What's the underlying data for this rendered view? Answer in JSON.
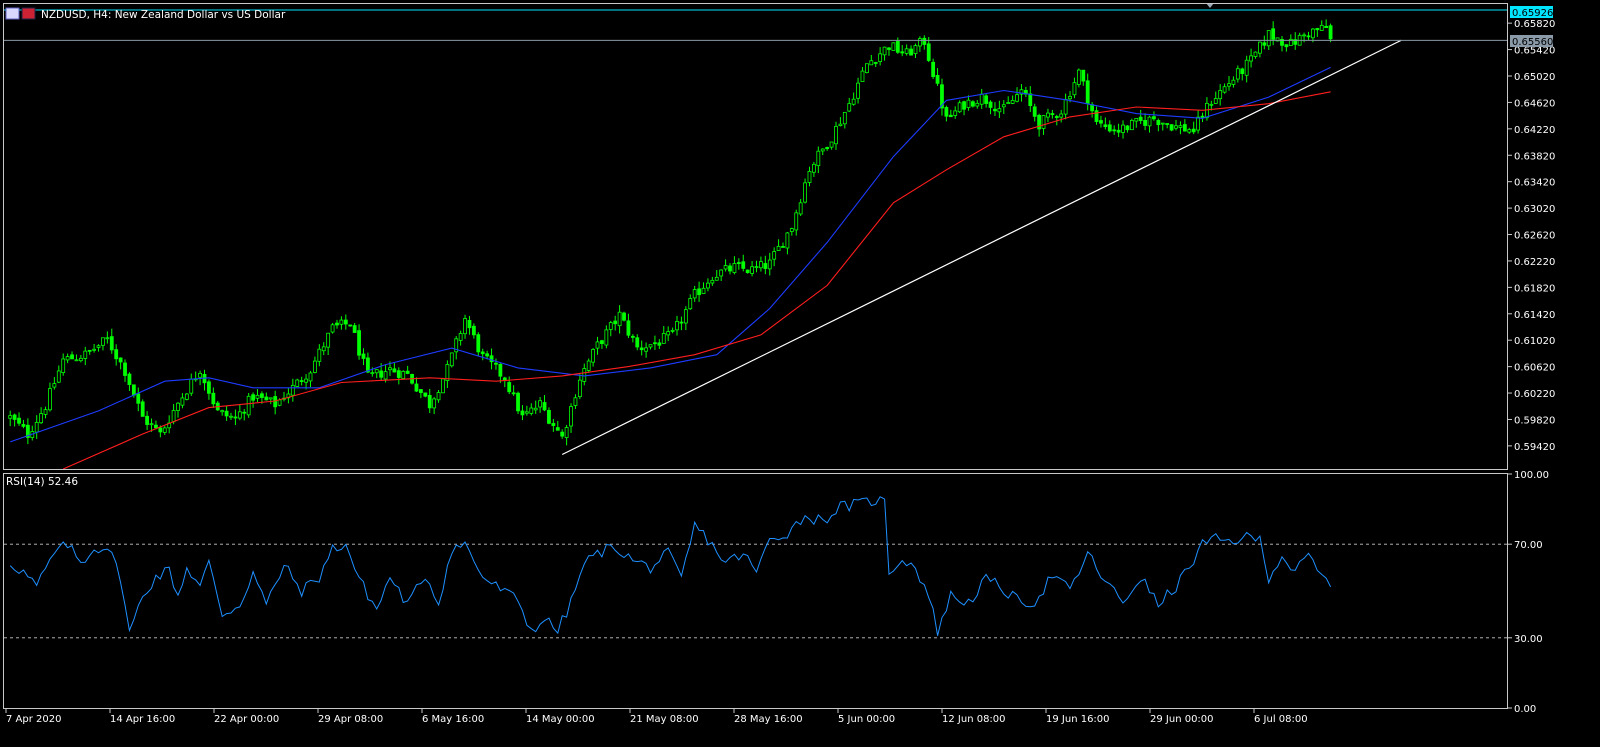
{
  "header": {
    "title": "NZDUSD, H4:  New Zealand Dollar vs US Dollar"
  },
  "colors": {
    "background": "#000000",
    "frame": "#c8c8c8",
    "candle": "#00ff00",
    "ma_fast": "#1e3cff",
    "ma_slow": "#ff1e1e",
    "trendline": "#ffffff",
    "rsi": "#1e90ff",
    "ask_line": "#00e5ff",
    "bid_line": "#8a9aa8",
    "ask_tag_bg": "#00e5ff",
    "bid_tag_bg": "#8a9aa8",
    "text": "#ffffff"
  },
  "price_tags": {
    "ask": "0.65926",
    "bid": "0.65560"
  },
  "indicator": {
    "label": "RSI(14) 52.46"
  },
  "chart_data": [
    {
      "type": "candlestick",
      "symbol": "NZDUSD",
      "timeframe": "H4",
      "ylim": [
        0.5907,
        0.6611
      ],
      "yticks": [
        "0.65820",
        "0.65420",
        "0.65020",
        "0.64620",
        "0.64220",
        "0.63820",
        "0.63420",
        "0.63020",
        "0.62620",
        "0.62220",
        "0.61820",
        "0.61420",
        "0.61020",
        "0.60620",
        "0.60220",
        "0.59820",
        "0.59420"
      ],
      "xticks": [
        "7 Apr 2020",
        "14 Apr 16:00",
        "22 Apr 00:00",
        "29 Apr 08:00",
        "6 May 16:00",
        "14 May 00:00",
        "21 May 08:00",
        "28 May 16:00",
        "5 Jun 00:00",
        "12 Jun 08:00",
        "19 Jun 16:00",
        "29 Jun 00:00",
        "6 Jul 08:00"
      ],
      "n_bars": 300,
      "close_path": [
        [
          0,
          0.5985
        ],
        [
          4,
          0.596
        ],
        [
          8,
          0.6003
        ],
        [
          12,
          0.6072
        ],
        [
          17,
          0.608
        ],
        [
          22,
          0.6103
        ],
        [
          26,
          0.6056
        ],
        [
          30,
          0.5985
        ],
        [
          34,
          0.596
        ],
        [
          38,
          0.6007
        ],
        [
          43,
          0.6059
        ],
        [
          47,
          0.5993
        ],
        [
          51,
          0.5983
        ],
        [
          55,
          0.6017
        ],
        [
          60,
          0.6005
        ],
        [
          64,
          0.603
        ],
        [
          68,
          0.6058
        ],
        [
          73,
          0.612
        ],
        [
          77,
          0.6128
        ],
        [
          81,
          0.6045
        ],
        [
          86,
          0.6058
        ],
        [
          90,
          0.605
        ],
        [
          95,
          0.6005
        ],
        [
          99,
          0.6058
        ],
        [
          103,
          0.6135
        ],
        [
          107,
          0.6076
        ],
        [
          112,
          0.6045
        ],
        [
          116,
          0.5985
        ],
        [
          120,
          0.6005
        ],
        [
          125,
          0.5955
        ],
        [
          129,
          0.6045
        ],
        [
          133,
          0.6094
        ],
        [
          138,
          0.614
        ],
        [
          142,
          0.609
        ],
        [
          146,
          0.6097
        ],
        [
          150,
          0.611
        ],
        [
          155,
          0.617
        ],
        [
          159,
          0.62
        ],
        [
          164,
          0.6212
        ],
        [
          168,
          0.6208
        ],
        [
          172,
          0.6218
        ],
        [
          177,
          0.6275
        ],
        [
          181,
          0.6362
        ],
        [
          186,
          0.641
        ],
        [
          190,
          0.646
        ],
        [
          194,
          0.652
        ],
        [
          199,
          0.6548
        ],
        [
          203,
          0.6535
        ],
        [
          207,
          0.6555
        ],
        [
          212,
          0.6435
        ],
        [
          216,
          0.646
        ],
        [
          220,
          0.647
        ],
        [
          225,
          0.645
        ],
        [
          229,
          0.648
        ],
        [
          233,
          0.643
        ],
        [
          238,
          0.645
        ],
        [
          242,
          0.6508
        ],
        [
          246,
          0.643
        ],
        [
          251,
          0.642
        ],
        [
          255,
          0.643
        ],
        [
          259,
          0.6438
        ],
        [
          264,
          0.6425
        ],
        [
          268,
          0.642
        ],
        [
          272,
          0.6465
        ],
        [
          277,
          0.6498
        ],
        [
          281,
          0.6525
        ],
        [
          285,
          0.6565
        ],
        [
          290,
          0.655
        ],
        [
          294,
          0.6568
        ],
        [
          298,
          0.6575
        ],
        [
          299,
          0.6556
        ]
      ],
      "series": [
        {
          "kind": "moving-average-fast",
          "color": "#1e3cff",
          "points": [
            [
              0,
              0.5948
            ],
            [
              20,
              0.5995
            ],
            [
              35,
              0.604
            ],
            [
              45,
              0.6045
            ],
            [
              55,
              0.603
            ],
            [
              70,
              0.603
            ],
            [
              85,
              0.6065
            ],
            [
              100,
              0.609
            ],
            [
              115,
              0.606
            ],
            [
              130,
              0.6048
            ],
            [
              145,
              0.606
            ],
            [
              160,
              0.608
            ],
            [
              172,
              0.615
            ],
            [
              185,
              0.625
            ],
            [
              200,
              0.638
            ],
            [
              212,
              0.6465
            ],
            [
              225,
              0.648
            ],
            [
              240,
              0.6465
            ],
            [
              255,
              0.6445
            ],
            [
              270,
              0.6438
            ],
            [
              285,
              0.647
            ],
            [
              299,
              0.6515
            ]
          ]
        },
        {
          "kind": "moving-average-slow",
          "color": "#ff1e1e",
          "points": [
            [
              12,
              0.5907
            ],
            [
              30,
              0.596
            ],
            [
              45,
              0.6
            ],
            [
              60,
              0.601
            ],
            [
              75,
              0.6038
            ],
            [
              95,
              0.6045
            ],
            [
              110,
              0.604
            ],
            [
              125,
              0.6048
            ],
            [
              140,
              0.6062
            ],
            [
              155,
              0.608
            ],
            [
              170,
              0.611
            ],
            [
              185,
              0.6185
            ],
            [
              200,
              0.631
            ],
            [
              212,
              0.636
            ],
            [
              225,
              0.641
            ],
            [
              240,
              0.644
            ],
            [
              255,
              0.6455
            ],
            [
              270,
              0.645
            ],
            [
              285,
              0.646
            ],
            [
              299,
              0.6478
            ]
          ]
        },
        {
          "kind": "trendline",
          "color": "#ffffff",
          "points": [
            [
              125,
              0.5929
            ],
            [
              315,
              0.6556
            ]
          ]
        }
      ]
    },
    {
      "type": "line",
      "title": "RSI(14) 52.46",
      "ylim": [
        0,
        100
      ],
      "yticks": [
        "100.00",
        "70.00",
        "30.00",
        "0.00"
      ],
      "levels": [
        70,
        30
      ],
      "series": [
        {
          "name": "RSI(14)",
          "color": "#1e90ff",
          "points": [
            [
              0,
              62
            ],
            [
              3,
              58
            ],
            [
              6,
              52
            ],
            [
              10,
              66
            ],
            [
              13,
              70
            ],
            [
              16,
              62
            ],
            [
              19,
              68
            ],
            [
              22,
              69
            ],
            [
              25,
              56
            ],
            [
              27,
              32
            ],
            [
              30,
              48
            ],
            [
              33,
              56
            ],
            [
              36,
              59
            ],
            [
              38,
              48
            ],
            [
              40,
              60
            ],
            [
              43,
              52
            ],
            [
              45,
              62
            ],
            [
              48,
              40
            ],
            [
              52,
              44
            ],
            [
              55,
              58
            ],
            [
              58,
              44
            ],
            [
              62,
              61
            ],
            [
              66,
              50
            ],
            [
              70,
              56
            ],
            [
              73,
              68
            ],
            [
              76,
              70
            ],
            [
              79,
              55
            ],
            [
              83,
              42
            ],
            [
              86,
              56
            ],
            [
              90,
              44
            ],
            [
              94,
              57
            ],
            [
              97,
              45
            ],
            [
              100,
              68
            ],
            [
              103,
              70
            ],
            [
              107,
              56
            ],
            [
              110,
              52
            ],
            [
              115,
              46
            ],
            [
              118,
              33
            ],
            [
              121,
              38
            ],
            [
              124,
              33
            ],
            [
              127,
              45
            ],
            [
              130,
              62
            ],
            [
              134,
              67
            ],
            [
              137,
              69
            ],
            [
              141,
              63
            ],
            [
              145,
              60
            ],
            [
              149,
              66
            ],
            [
              152,
              55
            ],
            [
              155,
              78
            ],
            [
              158,
              72
            ],
            [
              162,
              62
            ],
            [
              166,
              66
            ],
            [
              169,
              58
            ],
            [
              172,
              72
            ],
            [
              176,
              75
            ],
            [
              180,
              82
            ],
            [
              184,
              80
            ],
            [
              188,
              86
            ],
            [
              192,
              87
            ],
            [
              196,
              89
            ],
            [
              198,
              88
            ],
            [
              199,
              58
            ],
            [
              202,
              64
            ],
            [
              205,
              60
            ],
            [
              208,
              48
            ],
            [
              210,
              33
            ],
            [
              213,
              48
            ],
            [
              217,
              45
            ],
            [
              221,
              55
            ],
            [
              224,
              52
            ],
            [
              228,
              46
            ],
            [
              232,
              45
            ],
            [
              236,
              57
            ],
            [
              240,
              50
            ],
            [
              244,
              66
            ],
            [
              248,
              54
            ],
            [
              252,
              45
            ],
            [
              256,
              56
            ],
            [
              260,
              44
            ],
            [
              264,
              52
            ],
            [
              267,
              60
            ],
            [
              270,
              70
            ],
            [
              273,
              72
            ],
            [
              276,
              71
            ],
            [
              279,
              73
            ],
            [
              283,
              72
            ],
            [
              285,
              56
            ],
            [
              288,
              65
            ],
            [
              291,
              58
            ],
            [
              294,
              65
            ],
            [
              297,
              56
            ],
            [
              299,
              52
            ]
          ]
        }
      ]
    }
  ]
}
